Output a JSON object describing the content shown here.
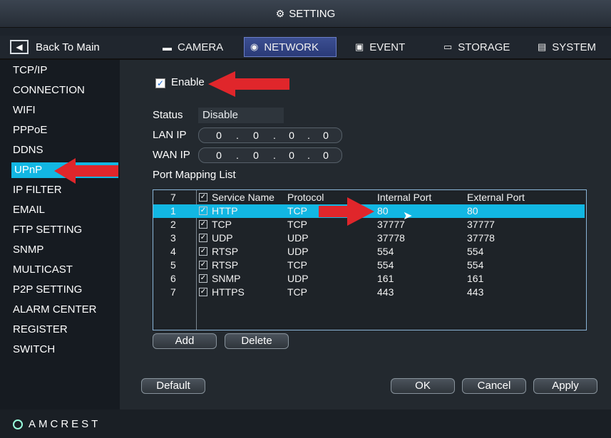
{
  "window": {
    "title": "SETTING"
  },
  "nav": {
    "back_label": "Back To Main",
    "tabs": [
      {
        "label": "CAMERA",
        "active": false
      },
      {
        "label": "NETWORK",
        "active": true
      },
      {
        "label": "EVENT",
        "active": false
      },
      {
        "label": "STORAGE",
        "active": false
      },
      {
        "label": "SYSTEM",
        "active": false
      }
    ]
  },
  "sidebar": {
    "items": [
      {
        "label": "TCP/IP"
      },
      {
        "label": "CONNECTION"
      },
      {
        "label": "WIFI"
      },
      {
        "label": "PPPoE"
      },
      {
        "label": "DDNS"
      },
      {
        "label": "UPnP",
        "active": true
      },
      {
        "label": "IP FILTER"
      },
      {
        "label": "EMAIL"
      },
      {
        "label": "FTP SETTING"
      },
      {
        "label": "SNMP"
      },
      {
        "label": "MULTICAST"
      },
      {
        "label": "P2P SETTING"
      },
      {
        "label": "ALARM CENTER"
      },
      {
        "label": "REGISTER"
      },
      {
        "label": "SWITCH"
      }
    ]
  },
  "upnp": {
    "enable_label": "Enable",
    "enable_checked": true,
    "status_label": "Status",
    "status_value": "Disable",
    "lan_ip_label": "LAN IP",
    "lan_ip": [
      "0",
      "0",
      "0",
      "0"
    ],
    "wan_ip_label": "WAN IP",
    "wan_ip": [
      "0",
      "0",
      "0",
      "0"
    ],
    "port_mapping_label": "Port Mapping List",
    "table": {
      "count": "7",
      "headers": [
        "Service Name",
        "Protocol",
        "Internal Port",
        "External Port"
      ],
      "rows": [
        {
          "index": "1",
          "service": "HTTP",
          "protocol": "TCP",
          "internal": "80",
          "external": "80",
          "highlighted": true
        },
        {
          "index": "2",
          "service": "TCP",
          "protocol": "TCP",
          "internal": "37777",
          "external": "37777"
        },
        {
          "index": "3",
          "service": "UDP",
          "protocol": "UDP",
          "internal": "37778",
          "external": "37778"
        },
        {
          "index": "4",
          "service": "RTSP",
          "protocol": "UDP",
          "internal": "554",
          "external": "554"
        },
        {
          "index": "5",
          "service": "RTSP",
          "protocol": "TCP",
          "internal": "554",
          "external": "554"
        },
        {
          "index": "6",
          "service": "SNMP",
          "protocol": "UDP",
          "internal": "161",
          "external": "161"
        },
        {
          "index": "7",
          "service": "HTTPS",
          "protocol": "TCP",
          "internal": "443",
          "external": "443"
        }
      ]
    },
    "buttons": {
      "add": "Add",
      "delete": "Delete",
      "default": "Default",
      "ok": "OK",
      "cancel": "Cancel",
      "apply": "Apply"
    }
  },
  "footer": {
    "brand": "AMCREST"
  },
  "colors": {
    "accent": "#12b7e3",
    "arrow": "#e0262b",
    "tab_active": "#2f4187"
  }
}
